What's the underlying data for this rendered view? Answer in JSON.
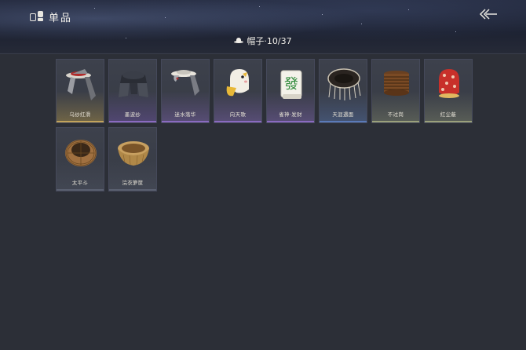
{
  "header": {
    "title": "单品",
    "category_label": "帽子·10/37"
  },
  "items": [
    {
      "label": "乌纱红滑",
      "icon": "black-gauze-hat-icon",
      "glow": "#b89a4a"
    },
    {
      "label": "墨波纱",
      "icon": "ink-gauze-hat-icon",
      "glow": "#7a5ab8"
    },
    {
      "label": "迷水落华",
      "icon": "veil-hat-icon",
      "glow": "#8a6ac0"
    },
    {
      "label": "向天歌",
      "icon": "goose-hat-icon",
      "glow": "#8a6ac0"
    },
    {
      "label": "雀神·发财",
      "icon": "mahjong-tile-icon",
      "glow": "#8a6ac0"
    },
    {
      "label": "天涯遇面",
      "icon": "fringed-hat-icon",
      "glow": "#5a7ab8"
    },
    {
      "label": "不过岗",
      "icon": "stacked-bowls-icon",
      "glow": "#9aa07a"
    },
    {
      "label": "红尘蔽",
      "icon": "red-bag-icon",
      "glow": "#9aa07a"
    },
    {
      "label": "太平斗",
      "icon": "woven-hat-icon",
      "glow": "#5a6070"
    },
    {
      "label": "浣衣箩筐",
      "icon": "basket-icon",
      "glow": "#5a6070"
    }
  ]
}
